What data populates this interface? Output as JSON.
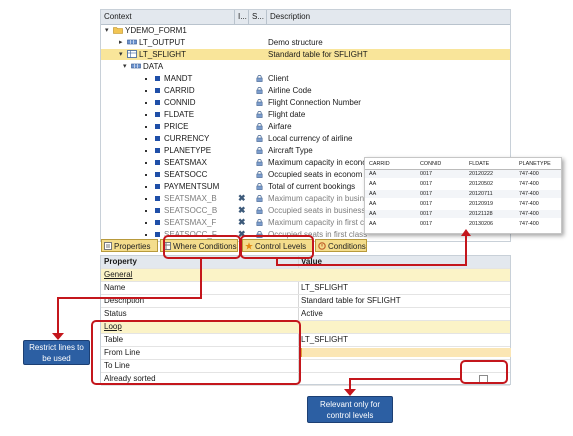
{
  "tree": {
    "headers": [
      "Context",
      "I...",
      "S...",
      "Description"
    ],
    "nodes": [
      {
        "label": "YDEMO_FORM1",
        "description": "",
        "kind": "folder",
        "indent": 0,
        "expanded": true
      },
      {
        "label": "LT_OUTPUT",
        "description": "Demo structure",
        "kind": "structure",
        "indent": 1,
        "expanded": false
      },
      {
        "label": "LT_SFLIGHT",
        "description": "Standard table for SFLIGHT",
        "kind": "table",
        "indent": 1,
        "expanded": true,
        "selected": true
      },
      {
        "label": "DATA",
        "description": "",
        "kind": "structure",
        "indent": 2,
        "expanded": true
      },
      {
        "label": "MANDT",
        "description": "Client",
        "kind": "field",
        "indent": 3
      },
      {
        "label": "CARRID",
        "description": "Airline Code",
        "kind": "field",
        "indent": 3
      },
      {
        "label": "CONNID",
        "description": "Flight Connection Number",
        "kind": "field",
        "indent": 3
      },
      {
        "label": "FLDATE",
        "description": "Flight date",
        "kind": "field",
        "indent": 3
      },
      {
        "label": "PRICE",
        "description": "Airfare",
        "kind": "field",
        "indent": 3
      },
      {
        "label": "CURRENCY",
        "description": "Local currency of airline",
        "kind": "field",
        "indent": 3
      },
      {
        "label": "PLANETYPE",
        "description": "Aircraft Type",
        "kind": "field",
        "indent": 3
      },
      {
        "label": "SEATSMAX",
        "description": "Maximum capacity in econo",
        "kind": "field",
        "indent": 3
      },
      {
        "label": "SEATSOCC",
        "description": "Occupied seats in econom",
        "kind": "field",
        "indent": 3
      },
      {
        "label": "PAYMENTSUM",
        "description": "Total of current bookings",
        "kind": "field",
        "indent": 3
      },
      {
        "label": "SEATSMAX_B",
        "description": "Maximum capacity in busine",
        "kind": "field",
        "indent": 3,
        "inactive": true
      },
      {
        "label": "SEATSOCC_B",
        "description": "Occupied seats in business",
        "kind": "field",
        "indent": 3,
        "inactive": true
      },
      {
        "label": "SEATSMAX_F",
        "description": "Maximum capacity in first c",
        "kind": "field",
        "indent": 3,
        "inactive": true
      },
      {
        "label": "SEATSOCC_F",
        "description": "Occupied seats in first class",
        "kind": "field",
        "indent": 3,
        "inactive": true
      }
    ]
  },
  "preview": {
    "columns": [
      "CARRID",
      "CONNID",
      "FLDATE",
      "PLANETYPE"
    ],
    "rows": [
      [
        "AA",
        "0017",
        "20120222",
        "747-400"
      ],
      [
        "AA",
        "0017",
        "20120502",
        "747-400"
      ],
      [
        "AA",
        "0017",
        "20120711",
        "747-400"
      ],
      [
        "AA",
        "0017",
        "20120919",
        "747-400"
      ],
      [
        "AA",
        "0017",
        "20121128",
        "747-400"
      ],
      [
        "AA",
        "0017",
        "20130206",
        "747-400"
      ]
    ]
  },
  "tabs": [
    "Properties",
    "Where Conditions",
    "Control Levels",
    "Conditions"
  ],
  "properties": {
    "header": {
      "key": "Property",
      "value": "Value"
    },
    "rows": [
      {
        "key": "General",
        "value": "",
        "section": true
      },
      {
        "key": "Name",
        "value": "LT_SFLIGHT"
      },
      {
        "key": "Description",
        "value": "Standard table for SFLIGHT"
      },
      {
        "key": "Status",
        "value": "Active"
      },
      {
        "key": "Loop",
        "value": "",
        "section": true
      },
      {
        "key": "Table",
        "value": "LT_SFLIGHT"
      },
      {
        "key": "From Line",
        "value": ""
      },
      {
        "key": "To Line",
        "value": ""
      },
      {
        "key": "Already sorted",
        "value": "",
        "checkbox": true,
        "checked": false
      }
    ]
  },
  "callouts": {
    "restrict": "Restrict lines to be used",
    "relevant": "Relevant only for control levels"
  },
  "colors": {
    "selection": "#f9e59a",
    "tab": "#f4dd8c",
    "annotation_red": "#c4161c",
    "callout_blue": "#2c5fa3",
    "section_bg": "#fbf3c7"
  }
}
